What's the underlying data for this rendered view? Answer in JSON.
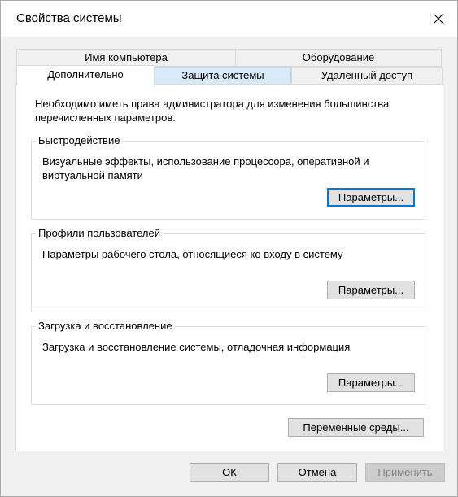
{
  "window": {
    "title": "Свойства системы",
    "close_icon": "close-icon"
  },
  "tabs": {
    "top_row": [
      {
        "label": "Имя компьютера"
      },
      {
        "label": "Оборудование"
      }
    ],
    "bottom_row": [
      {
        "label": "Дополнительно",
        "selected": true
      },
      {
        "label": "Защита системы",
        "hovered": true
      },
      {
        "label": "Удаленный доступ"
      }
    ]
  },
  "main": {
    "notice": "Необходимо иметь права администратора для изменения большинства перечисленных параметров.",
    "groups": [
      {
        "title": "Быстродействие",
        "description": "Визуальные эффекты, использование процессора, оперативной и виртуальной памяти",
        "button": "Параметры..."
      },
      {
        "title": "Профили пользователей",
        "description": "Параметры рабочего стола, относящиеся ко входу в систему",
        "button": "Параметры..."
      },
      {
        "title": "Загрузка и восстановление",
        "description": "Загрузка и восстановление системы, отладочная информация",
        "button": "Параметры..."
      }
    ],
    "env_button": "Переменные среды..."
  },
  "footer": {
    "ok": "ОК",
    "cancel": "Отмена",
    "apply": "Применить"
  },
  "colors": {
    "focus": "#0078d7",
    "tab_hover": "#d9ebf9",
    "dialog_bg": "#f0f0f0"
  }
}
